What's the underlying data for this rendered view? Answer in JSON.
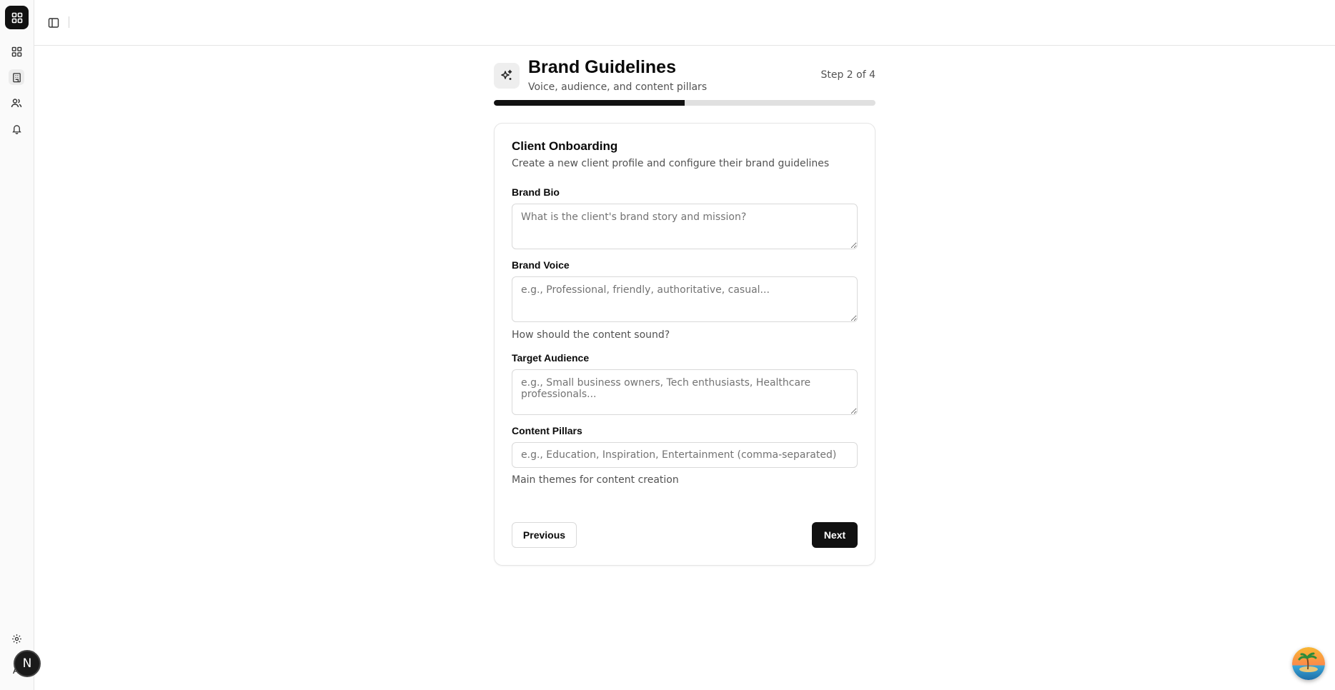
{
  "sidebar": {
    "items": [
      {
        "name": "dashboard",
        "icon": "grid-icon",
        "active": false
      },
      {
        "name": "clients",
        "icon": "building-icon",
        "active": true
      },
      {
        "name": "users",
        "icon": "users-icon",
        "active": false
      },
      {
        "name": "notifications",
        "icon": "bell-icon",
        "active": false
      }
    ],
    "avatar_initial": "N",
    "avatar_sub": "A"
  },
  "header": {
    "title": "Brand Guidelines",
    "subtitle": "Voice, audience, and content pillars",
    "step_text": "Step 2 of 4",
    "progress": 0.5
  },
  "card": {
    "title": "Client Onboarding",
    "description": "Create a new client profile and configure their brand guidelines",
    "fields": {
      "brand_bio": {
        "label": "Brand Bio",
        "placeholder": "What is the client's brand story and mission?",
        "value": ""
      },
      "brand_voice": {
        "label": "Brand Voice",
        "placeholder": "e.g., Professional, friendly, authoritative, casual...",
        "value": "",
        "hint": "How should the content sound?"
      },
      "target_audience": {
        "label": "Target Audience",
        "placeholder": "e.g., Small business owners, Tech enthusiasts, Healthcare professionals...",
        "value": ""
      },
      "content_pillars": {
        "label": "Content Pillars",
        "placeholder": "e.g., Education, Inspiration, Entertainment (comma-separated)",
        "value": "",
        "hint": "Main themes for content creation"
      }
    },
    "previous_label": "Previous",
    "next_label": "Next"
  },
  "colors": {
    "accent": "#111111",
    "progress_track": "#e0e0e0",
    "muted_text": "#525252"
  }
}
